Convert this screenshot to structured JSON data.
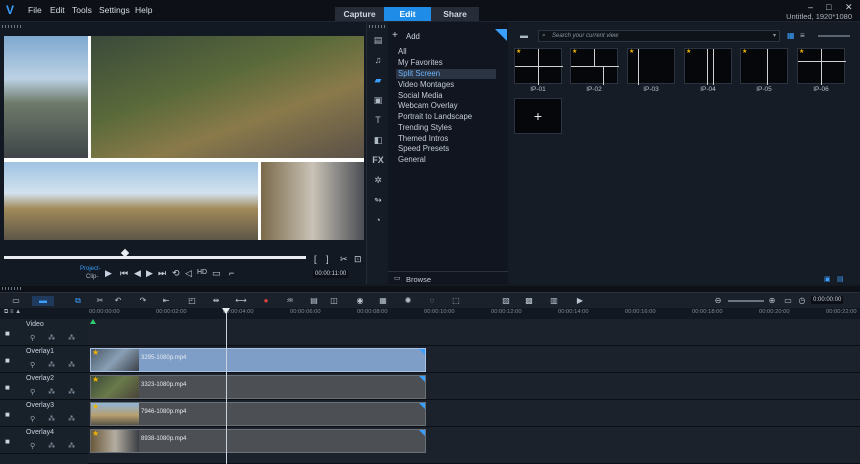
{
  "app": {
    "menu": [
      "File",
      "Edit",
      "Tools",
      "Settings",
      "Help"
    ],
    "mode_tabs": [
      "Capture",
      "Edit",
      "Share"
    ],
    "active_tab": "Edit",
    "doc_title": "Untitled, 1920*1080",
    "window_controls": {
      "minimize": "–",
      "maximize": "□",
      "close": "✕"
    }
  },
  "preview": {
    "project_label": "Project-",
    "clip_label": "Clip-",
    "hd_label": "HD",
    "timecode": "00:00:11:00"
  },
  "library": {
    "add_label": "Add",
    "search_placeholder": "Search your current view",
    "browse_label": "Browse",
    "categories": [
      "All",
      "My Favorites",
      "Split Screen",
      "Video Montages",
      "Social Media",
      "Webcam Overlay",
      "Portrait to Landscape",
      "Trending Styles",
      "Themed Intros",
      "Speed Presets",
      "General"
    ],
    "selected_category": "Split Screen",
    "templates": [
      "IP-01",
      "IP-02",
      "IP-03",
      "IP-04",
      "IP-05",
      "IP-06"
    ],
    "new_template_symbol": "+"
  },
  "timeline": {
    "timecode": "0:00:00:00",
    "ruler": [
      "00:00:00:00",
      "00:00:02:00",
      "00:00:04:00",
      "00:00:06:00",
      "00:00:08:00",
      "00:00:10:00",
      "00:00:12:00",
      "00:00:14:00",
      "00:00:16:00",
      "00:00:18:00",
      "00:00:20:00",
      "00:00:22:00"
    ],
    "tracks": [
      {
        "name": "Video",
        "clip": ""
      },
      {
        "name": "Overlay1",
        "clip": "3295-1080p.mp4"
      },
      {
        "name": "Overlay2",
        "clip": "3323-1080p.mp4"
      },
      {
        "name": "Overlay3",
        "clip": "7946-1080p.mp4"
      },
      {
        "name": "Overlay4",
        "clip": "8938-1080p.mp4"
      }
    ]
  },
  "colors": {
    "accent": "#1f8de8",
    "selected_clip": "#7e9dc7",
    "star": "#f0b400"
  }
}
